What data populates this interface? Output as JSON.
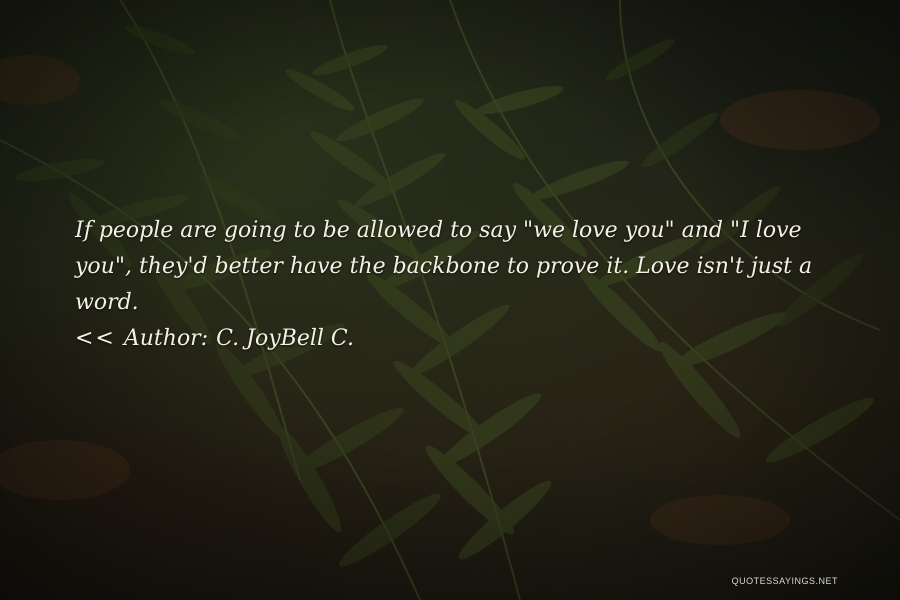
{
  "quote": {
    "text": "If people are going to be allowed to say \"we love you\" and \"I love you\", they'd better have the backbone to prove it. Love isn't just a word.",
    "author_arrows": "<<",
    "author_label": "Author:",
    "author_name": "C. JoyBell C."
  },
  "watermark": "QUOTESSAYINGS.NET",
  "colors": {
    "text": "#f3f0e6",
    "background": "#1a1c14",
    "fern": "#3f4a22"
  }
}
